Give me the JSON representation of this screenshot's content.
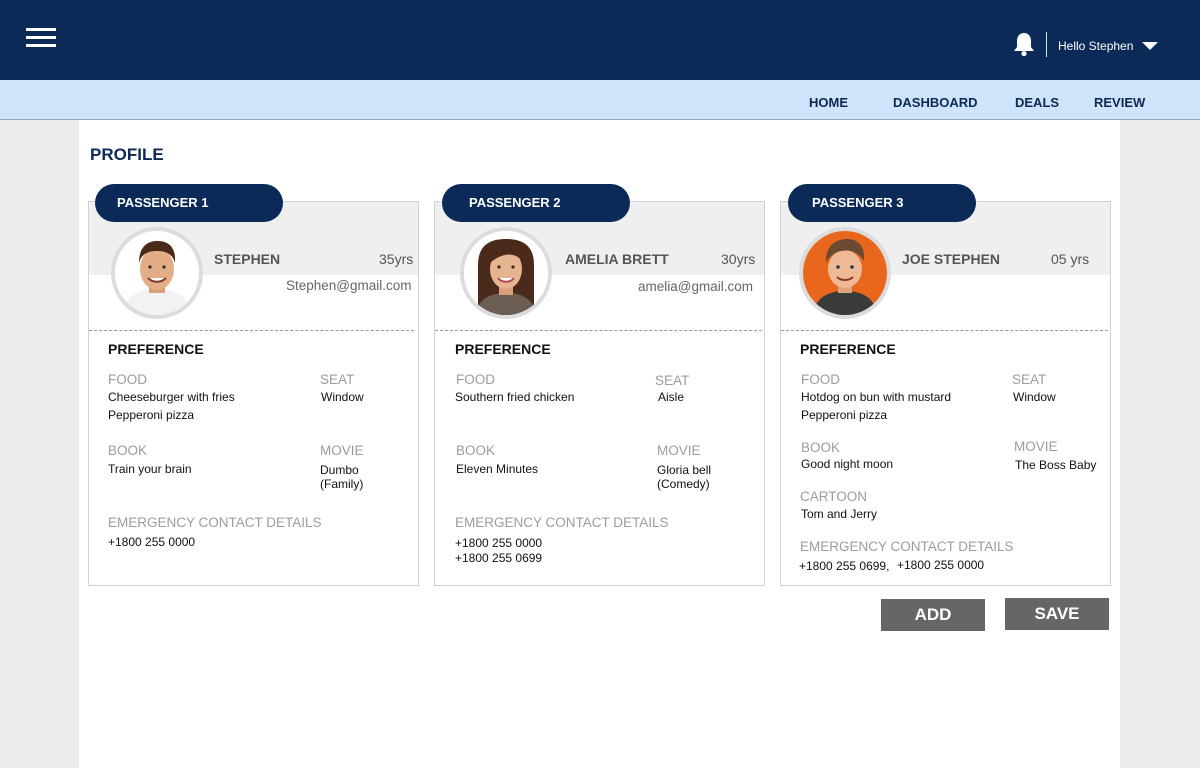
{
  "header": {
    "greeting": "Hello Stephen",
    "icons": [
      "menu-icon",
      "bell-icon",
      "caret-down-icon"
    ],
    "colors": {
      "topbar": "#0c2a57",
      "navbar": "#cfe3fb",
      "button": "#666666"
    }
  },
  "nav": {
    "items": [
      "HOME",
      "DASHBOARD",
      "DEALS",
      "REVIEW"
    ]
  },
  "page": {
    "title": "PROFILE"
  },
  "passengers": [
    {
      "pill": "PASSENGER 1",
      "name": "STEPHEN",
      "age": "35yrs",
      "email": "Stephen@gmail.com",
      "preference_label": "PREFERENCE",
      "food_label": "FOOD",
      "food": [
        "Cheeseburger with fries",
        "Pepperoni pizza"
      ],
      "seat_label": "SEAT",
      "seat": "Window",
      "book_label": "BOOK",
      "book": "Train your brain",
      "movie_label": "MOVIE",
      "movie": [
        "Dumbo",
        "(Family)"
      ],
      "emergency_label": "EMERGENCY CONTACT DETAILS",
      "emergency": [
        "+1800 255 0000"
      ]
    },
    {
      "pill": "PASSENGER 2",
      "name": "AMELIA BRETT",
      "age": "30yrs",
      "email": "amelia@gmail.com",
      "preference_label": "PREFERENCE",
      "food_label": "FOOD",
      "food": [
        "Southern fried chicken"
      ],
      "seat_label": "SEAT",
      "seat": "Aisle",
      "book_label": "BOOK",
      "book": "Eleven Minutes",
      "movie_label": "MOVIE",
      "movie": [
        "Gloria bell",
        "(Comedy)"
      ],
      "emergency_label": "EMERGENCY CONTACT DETAILS",
      "emergency": [
        "+1800 255 0000",
        "+1800 255 0699"
      ]
    },
    {
      "pill": "PASSENGER 3",
      "name": "JOE STEPHEN",
      "age": "05 yrs",
      "preference_label": "PREFERENCE",
      "food_label": "FOOD",
      "food": [
        "Hotdog on bun with mustard",
        "Pepperoni pizza"
      ],
      "seat_label": "SEAT",
      "seat": "Window",
      "book_label": "BOOK",
      "book": "Good night moon",
      "movie_label": "MOVIE",
      "movie": [
        "The Boss Baby"
      ],
      "cartoon_label": "CARTOON",
      "cartoon": "Tom and Jerry",
      "emergency_label": "EMERGENCY CONTACT DETAILS",
      "emergency": [
        "+1800 255 0699,",
        "+1800 255 0000"
      ]
    }
  ],
  "actions": {
    "add": "ADD",
    "save": "SAVE"
  }
}
